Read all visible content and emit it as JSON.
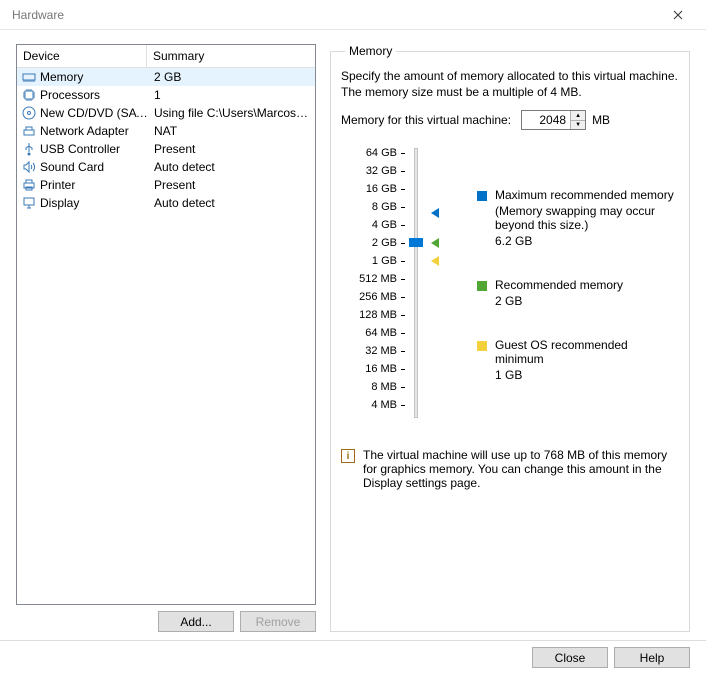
{
  "window": {
    "title": "Hardware"
  },
  "tableHeader": {
    "device": "Device",
    "summary": "Summary"
  },
  "devices": [
    {
      "name": "Memory",
      "summary": "2 GB",
      "icon": "memory-icon",
      "selected": true
    },
    {
      "name": "Processors",
      "summary": "1",
      "icon": "cpu-icon"
    },
    {
      "name": "New CD/DVD (SATA)",
      "summary": "Using file C:\\Users\\Marcos\\D...",
      "icon": "cd-icon"
    },
    {
      "name": "Network Adapter",
      "summary": "NAT",
      "icon": "network-icon"
    },
    {
      "name": "USB Controller",
      "summary": "Present",
      "icon": "usb-icon"
    },
    {
      "name": "Sound Card",
      "summary": "Auto detect",
      "icon": "sound-icon"
    },
    {
      "name": "Printer",
      "summary": "Present",
      "icon": "printer-icon"
    },
    {
      "name": "Display",
      "summary": "Auto detect",
      "icon": "display-icon"
    }
  ],
  "leftButtons": {
    "add": "Add...",
    "remove": "Remove"
  },
  "memory": {
    "legend": "Memory",
    "description": "Specify the amount of memory allocated to this virtual machine. The memory size must be a multiple of 4 MB.",
    "inputLabel": "Memory for this virtual machine:",
    "value": "2048",
    "unit": "MB",
    "ticks": [
      "64 GB",
      "32 GB",
      "16 GB",
      "8 GB",
      "4 GB",
      "2 GB",
      "1 GB",
      "512 MB",
      "256 MB",
      "128 MB",
      "64 MB",
      "32 MB",
      "16 MB",
      "8 MB",
      "4 MB"
    ],
    "sliderIndex": 5,
    "markers": {
      "maxIndex": 3.3,
      "recIndex": 5,
      "minIndex": 6
    },
    "legendItems": {
      "max": {
        "title": "Maximum recommended memory",
        "note": "(Memory swapping may occur beyond this size.)",
        "value": "6.2 GB"
      },
      "rec": {
        "title": "Recommended memory",
        "value": "2 GB"
      },
      "min": {
        "title": "Guest OS recommended minimum",
        "value": "1 GB"
      }
    },
    "note": "The virtual machine will use up to 768 MB of this memory for graphics memory. You can change this amount in the Display settings page."
  },
  "footer": {
    "close": "Close",
    "help": "Help"
  }
}
